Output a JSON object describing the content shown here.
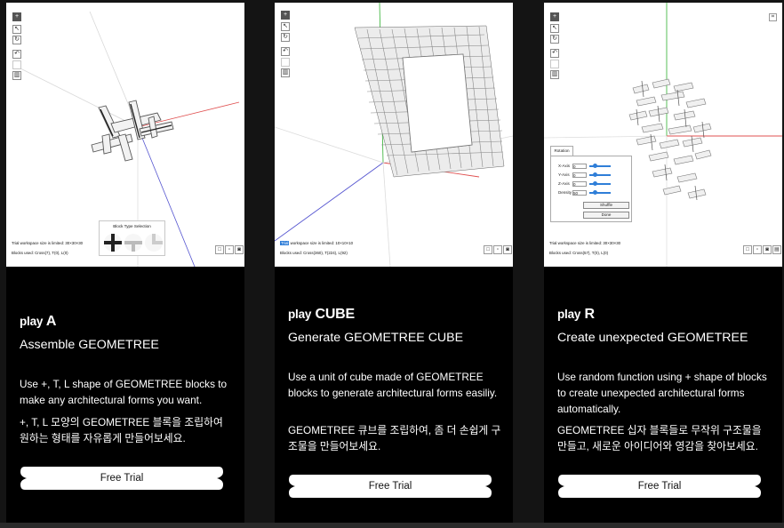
{
  "colors": {
    "accent": "#2f7ed8",
    "axis_x": "#e05050",
    "axis_y": "#46b846",
    "axis_z": "#5555d0",
    "card_bg": "#000000",
    "page_bg": "#141414"
  },
  "toolbar_icons": [
    "plus-icon",
    "select-icon",
    "rotate-icon",
    "undo-icon",
    "blank",
    "trash-icon"
  ],
  "cards": [
    {
      "play_word": "play",
      "play_letter": "A",
      "subtitle": "Assemble GEOMETREE",
      "desc_en": "Use +, T, L shape of GEOMETREE blocks to make any architectural forms you want.",
      "desc_ko": "+, T, L 모양의 GEOMETREE 블록을 조립하여 원하는 형태를 자유롭게 만들어보세요.",
      "button": "Free Trial",
      "info_line1": "Trial workspace size is limited: 30×30×30",
      "info_line2": "Blocks used: Cross(7), T(0), L(0)",
      "panel_title": "Block Type Selection"
    },
    {
      "play_word": "play",
      "play_letter": "CUBE",
      "subtitle": "Generate GEOMETREE CUBE",
      "desc_en": "Use a unit of cube made of GEOMETREE blocks to generate architectural forms easiliy.",
      "desc_ko": "GEOMETREE 큐브를 조립하여, 좀 더 손쉽게 구조물을 만들어보세요.",
      "button": "Free Trial",
      "info_highlight": "Trial",
      "info_line1": " workspace size is limited: 10×10×10",
      "info_line2": "Blocks used: Cross(360), T(224), L(92)"
    },
    {
      "play_word": "play",
      "play_letter": "R",
      "subtitle": "Create unexpected GEOMETREE",
      "desc_en": "Use random function using + shape of blocks to create unexpected architectural forms automatically.",
      "desc_ko": "GEOMETREE 십자 블록들로 무작위 구조물을 만들고, 새로운 아이디어와 영감을 찾아보세요.",
      "button": "Free Trial",
      "info_line1": "Trial workspace size is limited: 30×30×30",
      "info_line2": "Blocks used: Cross(57), T(0), L(0)",
      "rotation": {
        "tab": "Rotation",
        "x_label": "X-Axis",
        "x_val": "0",
        "y_label": "Y-Axis",
        "y_val": "0",
        "z_label": "Z-Axis",
        "z_val": "0",
        "d_label": "Density",
        "d_val": "50",
        "shuffle": "Shuffle",
        "done": "Done"
      }
    }
  ]
}
